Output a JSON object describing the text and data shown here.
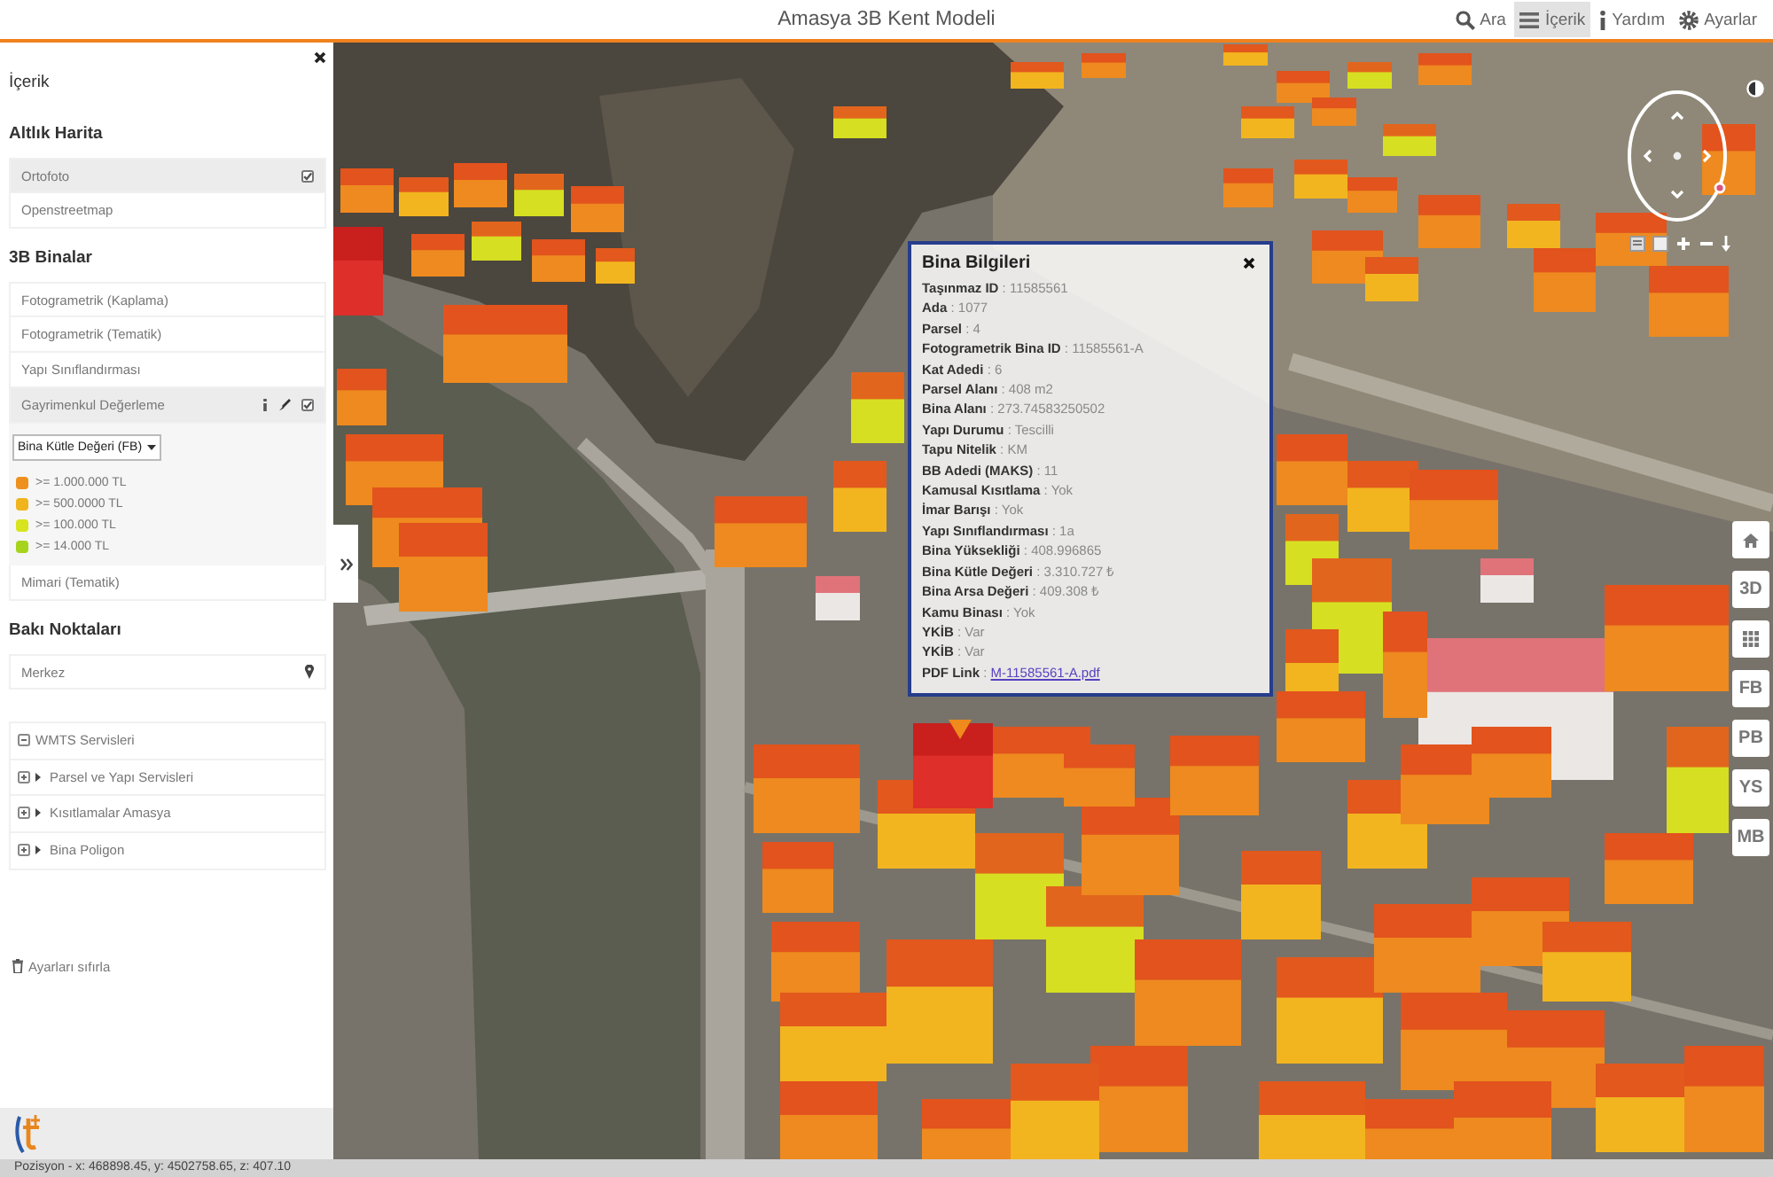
{
  "window": {
    "title": "Amasya 3B Kent Modeli"
  },
  "top_nav": [
    {
      "kind": "search",
      "label": "Ara",
      "selected": false
    },
    {
      "kind": "menu",
      "label": "İçerik",
      "selected": true
    },
    {
      "kind": "info",
      "label": "Yardım",
      "selected": false
    },
    {
      "kind": "settings",
      "label": "Ayarlar",
      "selected": false
    }
  ],
  "sidebar": {
    "title": "İçerik",
    "sections": [
      {
        "heading": "Altlık Harita",
        "kind": "layers",
        "items": [
          {
            "label": "Ortofoto",
            "checked": true
          },
          {
            "label": "Openstreetmap",
            "checked": false
          }
        ]
      },
      {
        "heading": "3B Binalar",
        "kind": "layers",
        "items": [
          {
            "label": "Fotogrametrik (Kaplama)",
            "checked": false
          },
          {
            "label": "Fotogrametrik (Tematik)",
            "checked": false
          },
          {
            "label": "Yapı Sınıflandırması",
            "checked": false
          },
          {
            "label": "Gayrimenkul Değerleme",
            "checked": true,
            "tools": true,
            "style_select": {
              "value": "Bina Kütle Değeri (FB)"
            },
            "legend": [
              {
                "label": ">= 1.000.000 TL",
                "color": "#ee901e"
              },
              {
                "label": ">= 500.0000 TL",
                "color": "#f0b41c"
              },
              {
                "label": ">= 100.000 TL",
                "color": "#d8e41e"
              },
              {
                "label": ">= 14.000 TL",
                "color": "#a6d41c"
              }
            ]
          },
          {
            "label": "Mimari (Tematik)",
            "checked": false
          }
        ]
      },
      {
        "heading": "Bakı Noktaları",
        "kind": "places",
        "items": [
          {
            "label": "Merkez"
          }
        ]
      }
    ],
    "services": [
      {
        "label": "WMTS Servisleri",
        "expanded": true,
        "children": [
          {
            "label": "Parsel ve Yapı Servisleri",
            "expanded": false
          },
          {
            "label": "Kısıtlamalar Amasya",
            "expanded": false
          },
          {
            "label": "Bina Poligon",
            "expanded": false
          }
        ]
      }
    ],
    "reset": {
      "label": "Ayarları sıfırla"
    }
  },
  "map": {
    "popup": {
      "title": "Bina Bilgileri",
      "rows": [
        {
          "kind": "text",
          "text": "**Taşınmaz ID** : 11585561"
        },
        {
          "kind": "text",
          "text": "**Ada** : 1077"
        },
        {
          "kind": "text",
          "text": "**Parsel** : 4"
        },
        {
          "kind": "text",
          "text": "**Fotogrametrik Bina ID** : 11585561-A"
        },
        {
          "kind": "text",
          "text": "**Kat Adedi** : 6"
        },
        {
          "kind": "text",
          "text": "**Parsel Alanı** : 408 m2"
        },
        {
          "kind": "text",
          "text": "**Bina Alanı** : 273.74583250502"
        },
        {
          "kind": "text",
          "text": "**Yapı Durumu** : Tescilli"
        },
        {
          "kind": "text",
          "text": "**Tapu Nitelik** : KM"
        },
        {
          "kind": "text",
          "text": "**BB Adedi (MAKS)** : 11"
        },
        {
          "kind": "text",
          "text": "**Kamusal Kısıtlama** : Yok"
        },
        {
          "kind": "text",
          "text": "**İmar Barışı** : Yok"
        },
        {
          "kind": "text",
          "text": "**Yapı Sınıflandırması** : 1a"
        },
        {
          "kind": "text",
          "text": "**Bina Yüksekliği** : 408.996865"
        },
        {
          "kind": "text",
          "text": "**Bina Kütle Değeri** : 3.310.727 ₺"
        },
        {
          "kind": "text",
          "text": "**Bina Arsa Değeri** : 409.308 ₺"
        },
        {
          "kind": "text",
          "text": "**Kamu Binası** : Yok"
        },
        {
          "kind": "text",
          "text": "**YKİB** : Var"
        },
        {
          "kind": "text",
          "text": "**YKİB** : Var"
        },
        {
          "kind": "link",
          "text": "**PDF Link** :",
          "link": "M-11585561-A.pdf"
        }
      ]
    },
    "side_buttons": [
      {
        "kind": "home"
      },
      {
        "kind": "text",
        "label": "3D"
      },
      {
        "kind": "grid"
      },
      {
        "kind": "text",
        "label": "FB"
      },
      {
        "kind": "text",
        "label": "PB"
      },
      {
        "kind": "text",
        "label": "YS"
      },
      {
        "kind": "text",
        "label": "MB"
      }
    ]
  },
  "status_bar": {
    "position": "Pozisyon - x: 468898.45, y: 4502758.65, z: 407.10"
  }
}
